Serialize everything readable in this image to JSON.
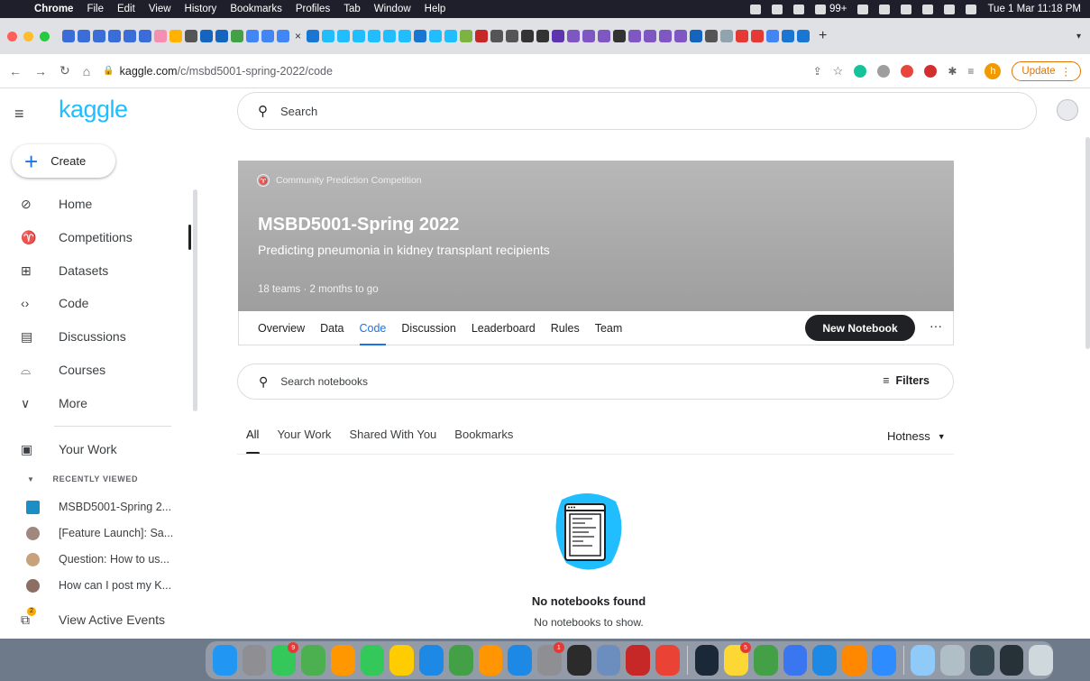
{
  "menubar": {
    "app": "Chrome",
    "items": [
      "File",
      "Edit",
      "View",
      "History",
      "Bookmarks",
      "Profiles",
      "Tab",
      "Window",
      "Help"
    ],
    "notif_count": "99+",
    "datetime": "Tue 1 Mar 11:18 PM"
  },
  "addressbar": {
    "url_host": "kaggle.com",
    "url_path": "/c/msbd5001-spring-2022/code",
    "update_label": "Update",
    "profile_initial": "h"
  },
  "sidebar": {
    "logo": "kaggle",
    "create_label": "Create",
    "nav": [
      {
        "label": "Home",
        "icon": "compass-icon"
      },
      {
        "label": "Competitions",
        "icon": "trophy-icon"
      },
      {
        "label": "Datasets",
        "icon": "table-icon"
      },
      {
        "label": "Code",
        "icon": "code-icon"
      },
      {
        "label": "Discussions",
        "icon": "comment-icon"
      },
      {
        "label": "Courses",
        "icon": "school-icon"
      },
      {
        "label": "More",
        "icon": "chevron-down-icon"
      }
    ],
    "your_work": "Your Work",
    "recently_viewed_heading": "RECENTLY VIEWED",
    "recent": [
      "MSBD5001-Spring 2...",
      "[Feature Launch]: Sa...",
      "Question: How to us...",
      "How can I post my K..."
    ],
    "active_events": "View Active Events",
    "active_events_badge": "2"
  },
  "search": {
    "placeholder": "Search"
  },
  "competition": {
    "type": "Community Prediction Competition",
    "title": "MSBD5001-Spring 2022",
    "subtitle": "Predicting pneumonia in kidney transplant recipients",
    "meta": "18 teams · 2 months to go",
    "tabs": [
      "Overview",
      "Data",
      "Code",
      "Discussion",
      "Leaderboard",
      "Rules",
      "Team"
    ],
    "active_tab": "Code",
    "new_notebook_label": "New Notebook",
    "more_label": "···"
  },
  "notebooks": {
    "search_placeholder": "Search notebooks",
    "filters_label": "Filters",
    "subtabs": [
      "All",
      "Your Work",
      "Shared With You",
      "Bookmarks"
    ],
    "sort_label": "Hotness",
    "empty_title": "No notebooks found",
    "empty_sub": "No notebooks to show."
  },
  "dock": {
    "badges": [
      "9",
      "1",
      "5"
    ]
  }
}
